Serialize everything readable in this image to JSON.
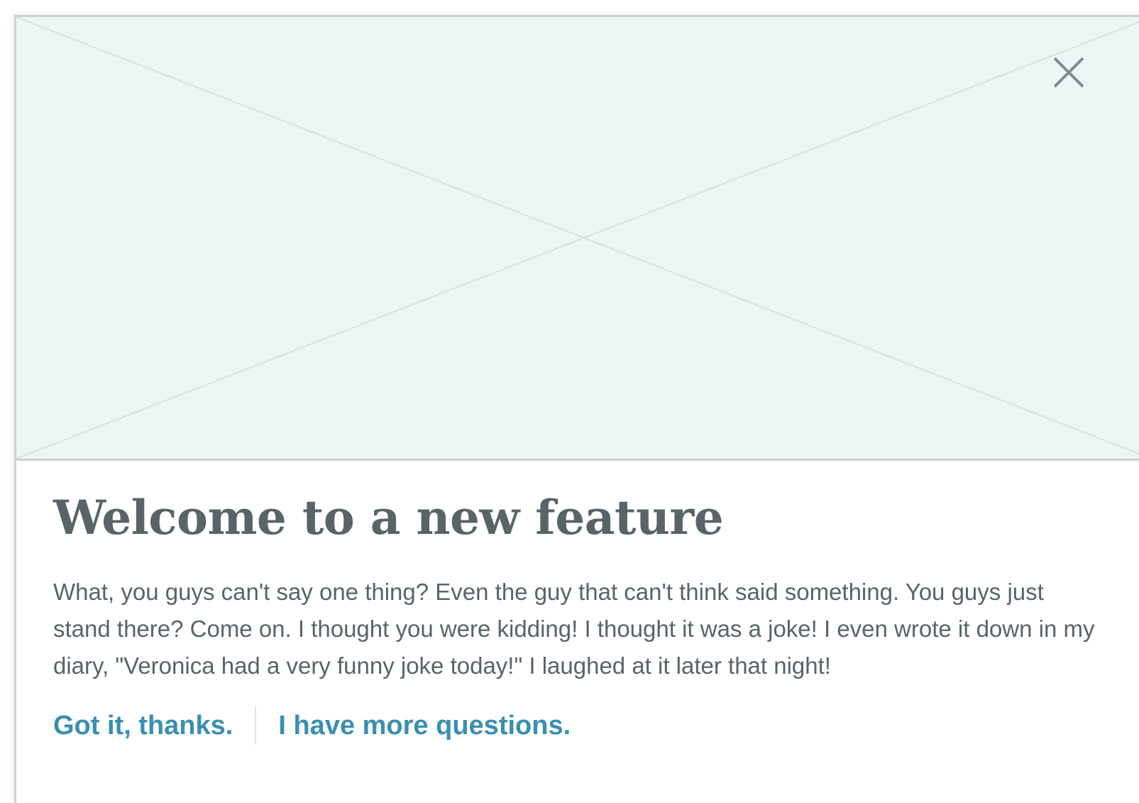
{
  "modal": {
    "title": "Welcome to a new feature",
    "body": "What, you guys can't say one thing? Even the guy that can't think said something. You guys just stand there? Come on. I thought you were kidding! I thought it was a joke! I even wrote it down in my diary, \"Veronica had a very funny joke today!\" I laughed at it later that night!",
    "close_icon": "close-icon",
    "hero_icon": "image-placeholder-icon",
    "actions": {
      "primary_label": "Got it, thanks.",
      "secondary_label": "I have more questions."
    }
  },
  "colors": {
    "hero_background": "#eef6f5",
    "hero_lines": "#d6e1e0",
    "border": "#c9d3d3",
    "text": "#596468",
    "link": "#3a8fb0",
    "close_icon": "#808a8c"
  }
}
